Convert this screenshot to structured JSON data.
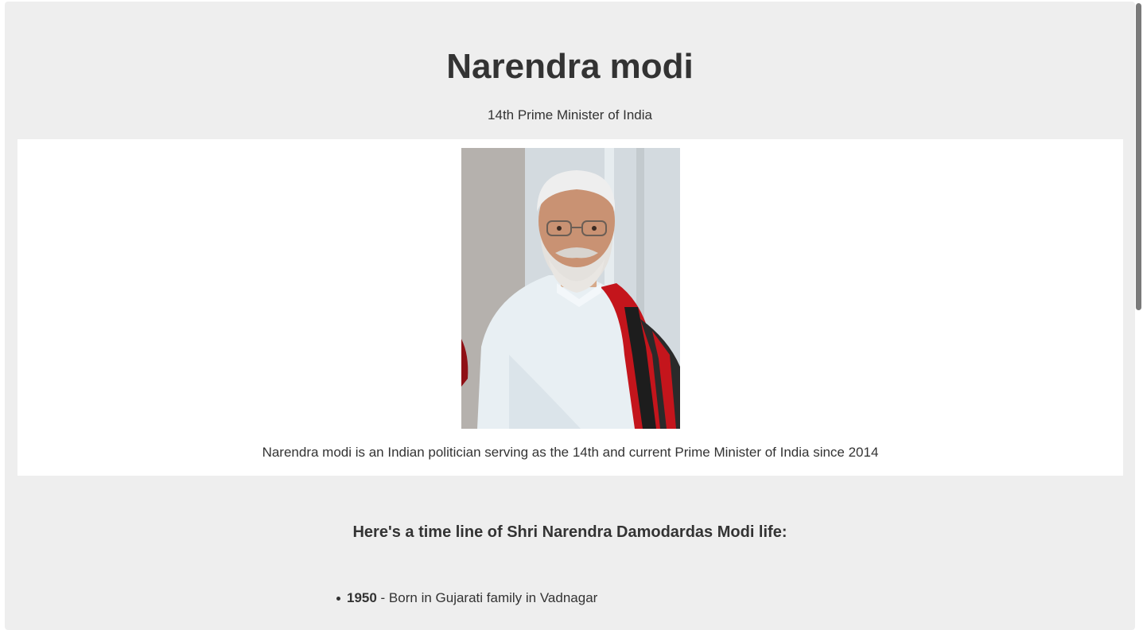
{
  "main": {
    "title": "Narendra modi",
    "subtitle": "14th Prime Minister of India"
  },
  "figure": {
    "image_alt": "Portrait of Narendra modi",
    "caption": "Narendra modi is an Indian politician serving as the 14th and current Prime Minister of India since 2014"
  },
  "tribute": {
    "heading": "Here's a time line of Shri Narendra Damodardas Modi life:",
    "items": [
      {
        "year": "1950",
        "text": " - Born in Gujarati family in Vadnagar"
      }
    ]
  },
  "colors": {
    "page_background": "#eeeeee",
    "figure_background": "#ffffff",
    "text": "#333333"
  }
}
